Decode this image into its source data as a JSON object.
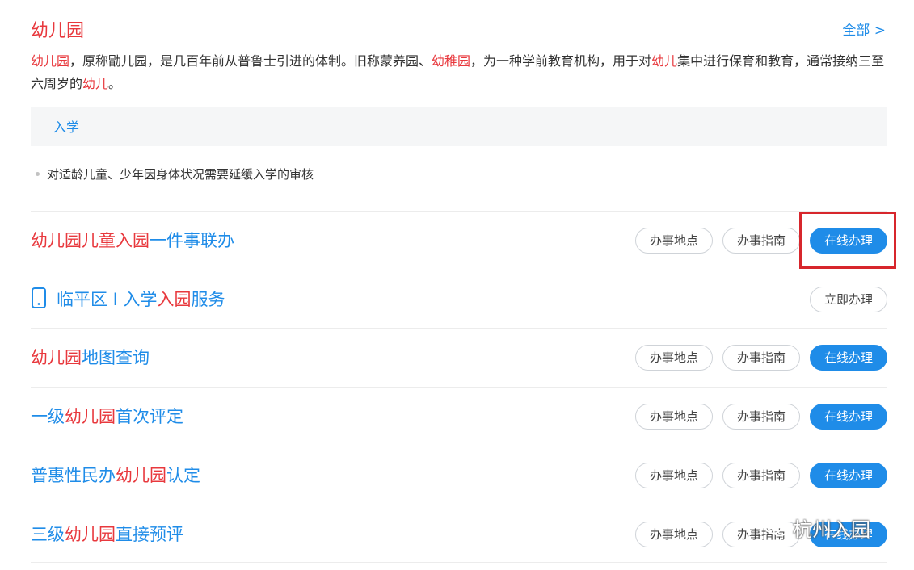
{
  "header": {
    "title": "幼儿园",
    "all_link": "全部 >"
  },
  "description": {
    "segments": [
      {
        "text": "幼儿园",
        "hl": true
      },
      {
        "text": "，原称勖儿园，是几百年前从普鲁士引进的体制。旧称蒙养园、",
        "hl": false
      },
      {
        "text": "幼稚园",
        "hl": true
      },
      {
        "text": "，为一种学前教育机构，用于对",
        "hl": false
      },
      {
        "text": "幼儿",
        "hl": true
      },
      {
        "text": "集中进行保育和教育，通常接纳三至六周岁的",
        "hl": false
      },
      {
        "text": "幼儿",
        "hl": true
      },
      {
        "text": "。",
        "hl": false
      }
    ]
  },
  "topic_tag": "入学",
  "sub_item": "对适龄儿童、少年因身体状况需要延缓入学的审核",
  "buttons": {
    "location": "办事地点",
    "guide": "办事指南",
    "online": "在线办理",
    "immediate": "立即办理"
  },
  "services": [
    {
      "segments": [
        {
          "text": "幼儿园儿童入园",
          "hl": true
        },
        {
          "text": "一件事联办",
          "hl": false
        }
      ],
      "type": "standard",
      "icon": null
    },
    {
      "segments": [
        {
          "text": "临平区 I 入学",
          "hl": false
        },
        {
          "text": "入园",
          "hl": true
        },
        {
          "text": "服务",
          "hl": false
        }
      ],
      "type": "immediate",
      "icon": "mobile-phone-icon"
    },
    {
      "segments": [
        {
          "text": "幼儿园",
          "hl": true
        },
        {
          "text": "地图查询",
          "hl": false
        }
      ],
      "type": "standard",
      "icon": null
    },
    {
      "segments": [
        {
          "text": "一级",
          "hl": false
        },
        {
          "text": "幼儿园",
          "hl": true
        },
        {
          "text": "首次评定",
          "hl": false
        }
      ],
      "type": "standard",
      "icon": null
    },
    {
      "segments": [
        {
          "text": "普惠性民办",
          "hl": false
        },
        {
          "text": "幼儿园",
          "hl": true
        },
        {
          "text": "认定",
          "hl": false
        }
      ],
      "type": "standard",
      "icon": null
    },
    {
      "segments": [
        {
          "text": "三级",
          "hl": false
        },
        {
          "text": "幼儿园",
          "hl": true
        },
        {
          "text": "直接预评",
          "hl": false
        }
      ],
      "type": "standard",
      "icon": null
    }
  ],
  "watermark": {
    "text": "杭州入园",
    "icon": "wechat-icon"
  },
  "colors": {
    "accent": "#1f8ce8",
    "highlight": "#e8383d",
    "annotation_box": "#d7262c"
  }
}
